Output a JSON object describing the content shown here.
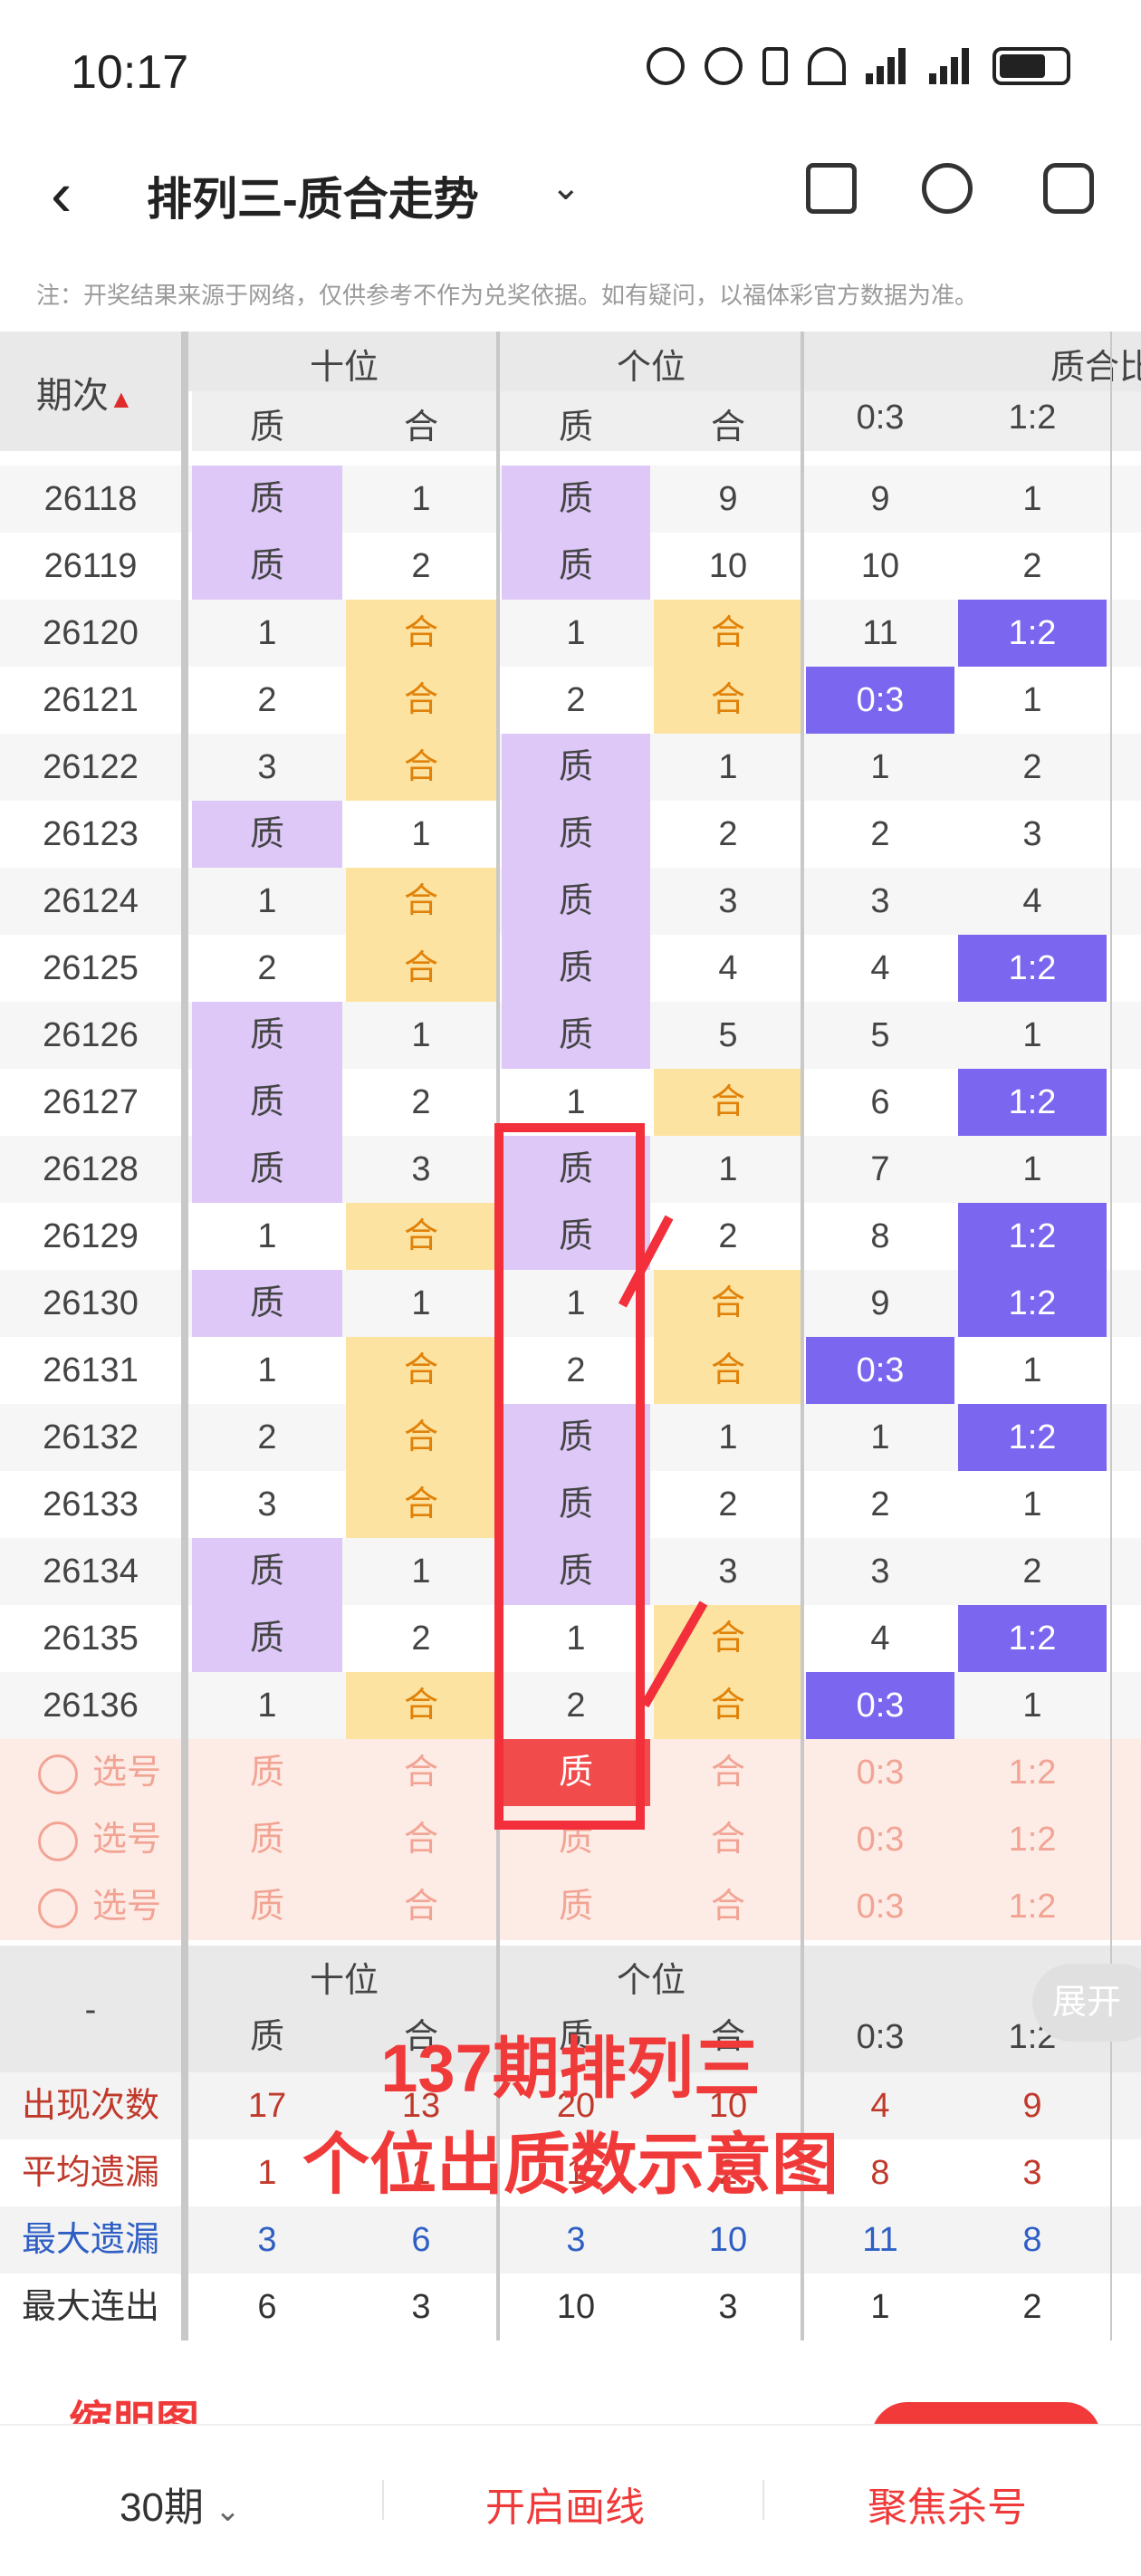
{
  "status_bar": {
    "time": "10:17"
  },
  "header": {
    "back_glyph": "‹",
    "title": "排列三-质合走势",
    "caret": "⌄"
  },
  "notice": "注：开奖结果来源于网络，仅供参考不作为兑奖依据。如有疑问，以福体彩官方数据为准。",
  "table": {
    "col_issue": "期次",
    "group_shi": "十位",
    "group_ge": "个位",
    "group_ratio": "质合比",
    "sub_zhi": "质",
    "sub_he": "合",
    "sub_r03": "0:3",
    "sub_r12": "1:2",
    "rows": [
      {
        "issue": "26118",
        "a": "质",
        "b": "1",
        "c": "质",
        "d": "9",
        "e": "9",
        "f": "1"
      },
      {
        "issue": "26119",
        "a": "质",
        "b": "2",
        "c": "质",
        "d": "10",
        "e": "10",
        "f": "2"
      },
      {
        "issue": "26120",
        "a": "1",
        "b": "合",
        "c": "1",
        "d": "合",
        "e": "11",
        "f": "1:2"
      },
      {
        "issue": "26121",
        "a": "2",
        "b": "合",
        "c": "2",
        "d": "合",
        "e": "0:3",
        "f": "1"
      },
      {
        "issue": "26122",
        "a": "3",
        "b": "合",
        "c": "质",
        "d": "1",
        "e": "1",
        "f": "2"
      },
      {
        "issue": "26123",
        "a": "质",
        "b": "1",
        "c": "质",
        "d": "2",
        "e": "2",
        "f": "3"
      },
      {
        "issue": "26124",
        "a": "1",
        "b": "合",
        "c": "质",
        "d": "3",
        "e": "3",
        "f": "4"
      },
      {
        "issue": "26125",
        "a": "2",
        "b": "合",
        "c": "质",
        "d": "4",
        "e": "4",
        "f": "1:2"
      },
      {
        "issue": "26126",
        "a": "质",
        "b": "1",
        "c": "质",
        "d": "5",
        "e": "5",
        "f": "1"
      },
      {
        "issue": "26127",
        "a": "质",
        "b": "2",
        "c": "1",
        "d": "合",
        "e": "6",
        "f": "1:2"
      },
      {
        "issue": "26128",
        "a": "质",
        "b": "3",
        "c": "质",
        "d": "1",
        "e": "7",
        "f": "1"
      },
      {
        "issue": "26129",
        "a": "1",
        "b": "合",
        "c": "质",
        "d": "2",
        "e": "8",
        "f": "1:2"
      },
      {
        "issue": "26130",
        "a": "质",
        "b": "1",
        "c": "1",
        "d": "合",
        "e": "9",
        "f": "1:2"
      },
      {
        "issue": "26131",
        "a": "1",
        "b": "合",
        "c": "2",
        "d": "合",
        "e": "0:3",
        "f": "1"
      },
      {
        "issue": "26132",
        "a": "2",
        "b": "合",
        "c": "质",
        "d": "1",
        "e": "1",
        "f": "1:2"
      },
      {
        "issue": "26133",
        "a": "3",
        "b": "合",
        "c": "质",
        "d": "2",
        "e": "2",
        "f": "1"
      },
      {
        "issue": "26134",
        "a": "质",
        "b": "1",
        "c": "质",
        "d": "3",
        "e": "3",
        "f": "2"
      },
      {
        "issue": "26135",
        "a": "质",
        "b": "2",
        "c": "1",
        "d": "合",
        "e": "4",
        "f": "1:2"
      },
      {
        "issue": "26136",
        "a": "1",
        "b": "合",
        "c": "2",
        "d": "合",
        "e": "0:3",
        "f": "1"
      }
    ],
    "select_label": "选号",
    "stats": [
      {
        "label": "出现次数",
        "v": [
          "17",
          "13",
          "20",
          "10",
          "4",
          "9"
        ],
        "color": "#c0392b"
      },
      {
        "label": "平均遗漏",
        "v": [
          "1",
          "1",
          "1",
          "2",
          "8",
          "3"
        ],
        "color": "#c0392b"
      },
      {
        "label": "最大遗漏",
        "v": [
          "3",
          "6",
          "3",
          "10",
          "11",
          "8"
        ],
        "color": "#2f5fc4"
      },
      {
        "label": "最大连出",
        "v": [
          "6",
          "3",
          "10",
          "3",
          "1",
          "2"
        ],
        "color": "#333333"
      }
    ],
    "stat_issue_placeholder": "-"
  },
  "annotation": {
    "line1": "137期排列三",
    "line2": "个位出质数示意图"
  },
  "expand_label": "展开",
  "card_title": "缩胆图",
  "bottom_bar": {
    "period": "30期",
    "draw": "开启画线",
    "kill": "聚焦杀号"
  },
  "colors": {
    "prime_bg": "#ddc8f7",
    "composite_bg": "#fde3a1",
    "ratio_bg": "#7b66ef",
    "accent": "#f03a3a"
  }
}
